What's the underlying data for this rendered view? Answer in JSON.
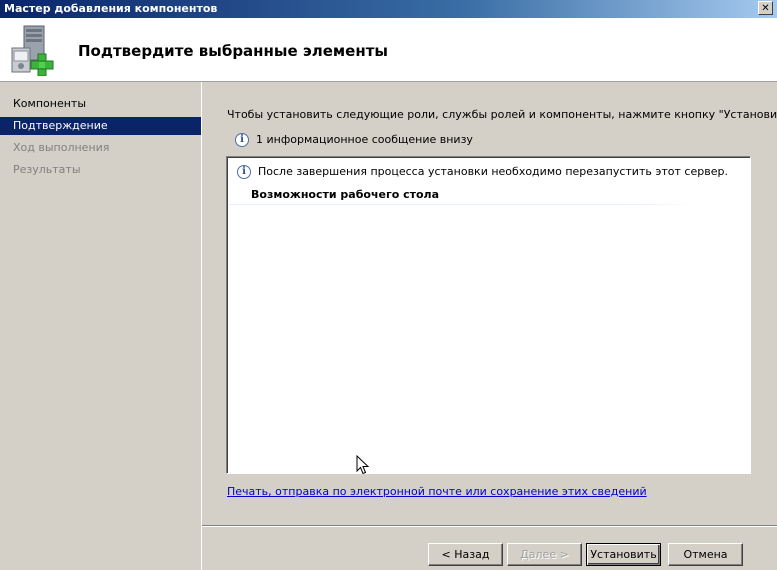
{
  "window": {
    "title": "Мастер добавления компонентов",
    "close_glyph": "✕"
  },
  "header": {
    "title": "Подтвердите выбранные элементы",
    "icon": "server-add-icon"
  },
  "sidebar": {
    "items": [
      {
        "label": "Компоненты",
        "state": "normal"
      },
      {
        "label": "Подтверждение",
        "state": "active"
      },
      {
        "label": "Ход выполнения",
        "state": "disabled"
      },
      {
        "label": "Результаты",
        "state": "disabled"
      }
    ]
  },
  "main": {
    "intro": "Чтобы установить следующие роли, службы ролей и компоненты, нажмите кнопку \"Установить\".",
    "info_count": "1 информационное сообщение внизу",
    "panel": {
      "message": "После завершения процесса установки необходимо перезапустить этот сервер.",
      "section_title": "Возможности рабочего стола"
    },
    "link": "Печать, отправка по электронной почте или сохранение этих сведений"
  },
  "buttons": {
    "back": "< Назад",
    "next": "Далее >",
    "install": "Установить",
    "cancel": "Отмена"
  },
  "colors": {
    "title_bar": "#0a246a",
    "selection": "#0a246a",
    "link": "#0000cc",
    "dialog_bg": "#d4d0c8"
  }
}
